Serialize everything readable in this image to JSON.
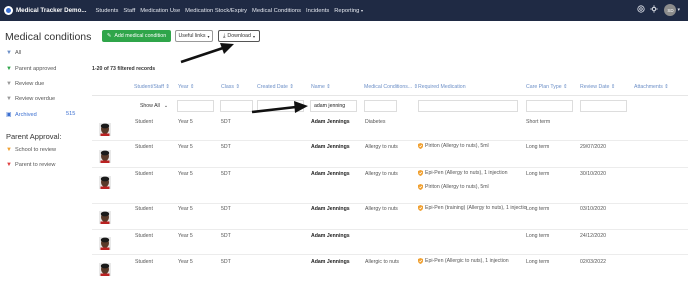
{
  "navbar": {
    "brand": "Medical Tracker Demo...",
    "items": [
      "Students",
      "Staff",
      "Medication Use",
      "Medication Stock/Expiry",
      "Medical Conditions",
      "Incidents",
      "Reporting"
    ],
    "avatar_initials": "SD"
  },
  "sidebar": {
    "title": "Medical conditions",
    "items": [
      {
        "label": "All",
        "icon": "filter-icon",
        "color": "#6c8fc7"
      },
      {
        "label": "Parent approved",
        "icon": "filter-icon",
        "color": "#2fa54a"
      },
      {
        "label": "Review due",
        "icon": "filter-icon",
        "color": "#999999"
      },
      {
        "label": "Review overdue",
        "icon": "filter-icon",
        "color": "#999999"
      },
      {
        "label": "Archived",
        "icon": "archive-icon",
        "color": "#3b6fd1",
        "count": "515"
      }
    ],
    "approval_heading": "Parent Approval:",
    "approval_items": [
      {
        "label": "School to review",
        "icon": "filter-icon",
        "color": "#f0a030"
      },
      {
        "label": "Parent to review",
        "icon": "filter-icon",
        "color": "#e04040"
      }
    ]
  },
  "toolbar": {
    "add_label": "Add medical condition",
    "links_label": "Useful links",
    "download_label": "Download"
  },
  "records": "1-20 of 73 filtered records",
  "table": {
    "headers": [
      "Student/Staff",
      "Year",
      "Class",
      "Created Date",
      "Name",
      "Medical Conditions...",
      "Required Medication",
      "Care Plan Type",
      "Review Date",
      "Attachments"
    ],
    "filter_show_all": "Show All",
    "filter_name_value": "adam jenning",
    "rows": [
      {
        "type": "Student",
        "year": "Year 5",
        "class": "5DT",
        "name": "Adam Jennings",
        "condition": "Diabetes",
        "meds": [],
        "care": "Short term",
        "review": ""
      },
      {
        "type": "Student",
        "year": "Year 5",
        "class": "5DT",
        "name": "Adam Jennings",
        "condition": "Allergy to nuts",
        "meds": [
          "Piriton (Allergy to nuts), 5ml"
        ],
        "care": "Long term",
        "review": "29/07/2020"
      },
      {
        "type": "Student",
        "year": "Year 5",
        "class": "5DT",
        "name": "Adam Jennings",
        "condition": "Allergy to nuts",
        "meds": [
          "Epi-Pen (Allergy to nuts), 1 injection",
          "Piriton (Allergy to nuts), 5ml"
        ],
        "care": "Long term",
        "review": "30/10/2020"
      },
      {
        "type": "Student",
        "year": "Year 5",
        "class": "5DT",
        "name": "Adam Jennings",
        "condition": "Allergy to nuts",
        "meds": [
          "Epi-Pen (training) (Allergy to nuts), 1 injectio"
        ],
        "care": "Long term",
        "review": "03/10/2020"
      },
      {
        "type": "Student",
        "year": "Year 5",
        "class": "5DT",
        "name": "Adam Jennings",
        "condition": "",
        "meds": [],
        "care": "Long term",
        "review": "24/12/2020"
      },
      {
        "type": "Student",
        "year": "Year 5",
        "class": "5DT",
        "name": "Adam Jennings",
        "condition": "Allergic to nuts",
        "meds": [
          "Epi-Pen (Allergic to nuts), 1 injection"
        ],
        "care": "Long term",
        "review": "02/03/2022"
      }
    ]
  },
  "colors": {
    "navbar": "#1f2a44",
    "add_button": "#2fa54a",
    "link": "#3b6fd1",
    "header_text": "#6c8fc7",
    "med_shield": "#f0a030"
  }
}
